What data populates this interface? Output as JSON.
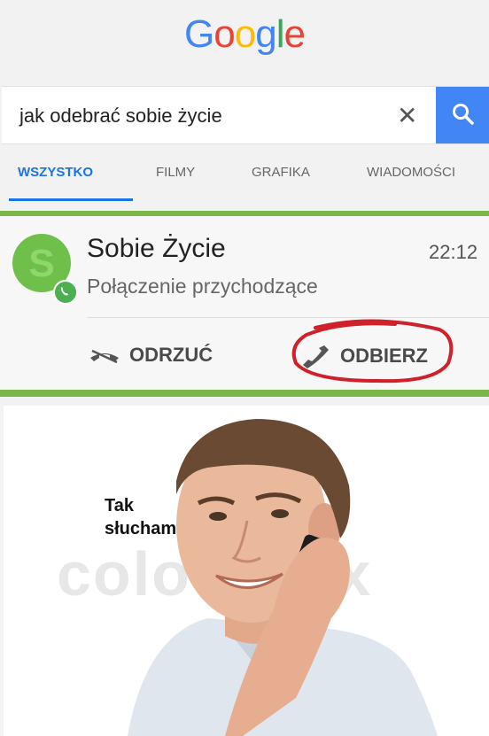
{
  "logo": "Google",
  "search": {
    "query": "jak odebrać sobie życie",
    "clear_icon": "close-icon",
    "submit_icon": "search-icon"
  },
  "tabs": [
    "WSZYSTKO",
    "FILMY",
    "GRAFIKA",
    "WIADOMOŚCI"
  ],
  "call": {
    "caller": "Sobie Życie",
    "time": "22:12",
    "status": "Połączenie przychodzące",
    "decline_label": "ODRZUĆ",
    "answer_label": "ODBIERZ"
  },
  "photo": {
    "speech": "Tak\nsłucham",
    "watermark": "colourbox"
  },
  "colors": {
    "accent": "#4285f4",
    "green_bar": "#7ab648",
    "red_circle": "#d0202a"
  }
}
